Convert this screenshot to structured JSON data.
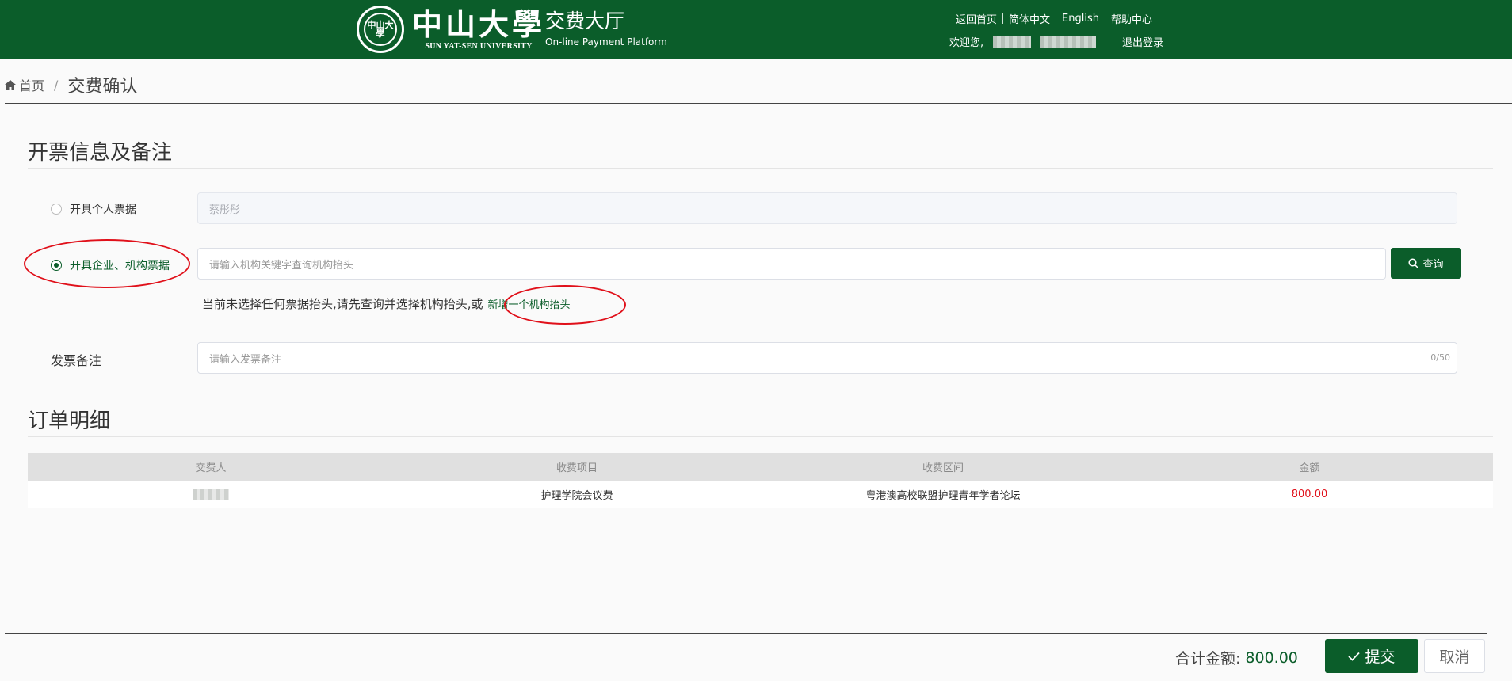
{
  "header": {
    "university_cn": "中山大學",
    "university_en": "SUN YAT-SEN UNIVERSITY",
    "seal_text": "中山大學",
    "platform_cn": "交费大厅",
    "platform_en": "On-line Payment Platform",
    "links": [
      "返回首页",
      "简体中文",
      "English",
      "帮助中心"
    ],
    "welcome": "欢迎您,",
    "logout": "退出登录",
    "bg_color": "#0b5d2a"
  },
  "breadcrumb": {
    "home": "首页",
    "separator": "/",
    "current": "交费确认"
  },
  "invoice": {
    "title": "开票信息及备注",
    "personal_label": "开具个人票据",
    "personal_value": "蔡彤彤",
    "org_label": "开具企业、机构票据",
    "org_placeholder": "请输入机构关键字查询机构抬头",
    "search_button": "查询",
    "hint_text": "当前未选择任何票据抬头,请先查询并选择机构抬头,或",
    "add_link": "新增一个机构抬头",
    "remark_label": "发票备注",
    "remark_placeholder": "请输入发票备注",
    "remark_counter": "0/50"
  },
  "order": {
    "title": "订单明细",
    "columns": [
      "交费人",
      "收费项目",
      "收费区间",
      "金额"
    ],
    "rows": [
      {
        "payer": "",
        "item": "护理学院会议费",
        "range": "粤港澳高校联盟护理青年学者论坛",
        "amount": "800.00"
      }
    ]
  },
  "footer": {
    "total_label": "合计金额:",
    "total_value": "800.00",
    "submit": "提交",
    "cancel": "取消"
  },
  "colors": {
    "primary": "#0b5d2a",
    "amount": "#e0101a",
    "annotation": "#e0101a"
  }
}
